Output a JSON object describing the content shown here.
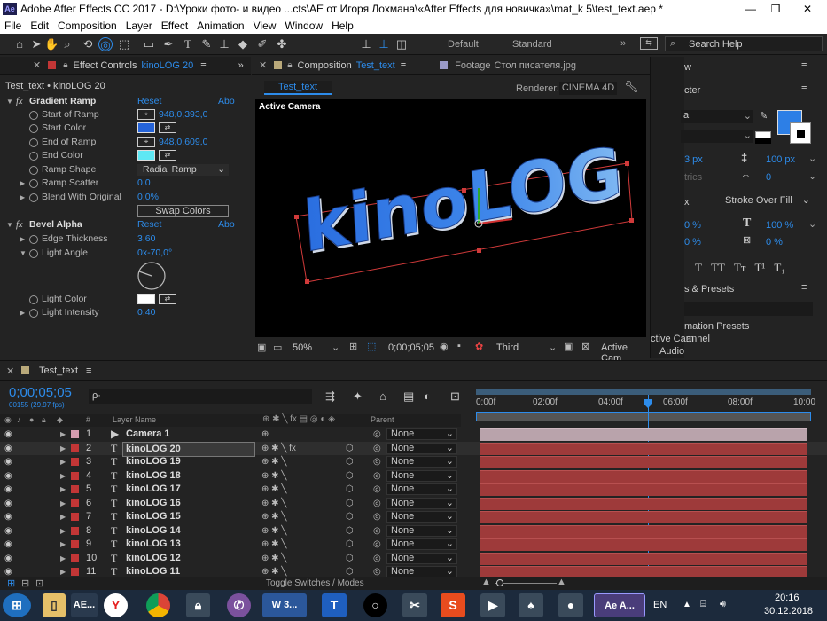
{
  "window": {
    "title": "Adobe After Effects CC 2017 - D:\\Уроки фото- и видео ...cts\\AE от Игоря Лохмана\\«After Effects для новичка»\\mat_k 5\\test_text.aep *",
    "min": "—",
    "max": "❐",
    "close": "✕"
  },
  "menu": [
    "File",
    "Edit",
    "Composition",
    "Layer",
    "Effect",
    "Animation",
    "View",
    "Window",
    "Help"
  ],
  "toolbar": {
    "workspaces": [
      "Default",
      "Standard"
    ],
    "search_placeholder": "Search Help"
  },
  "effect_controls": {
    "tab": "Effect Controls",
    "layer": "kinoLOG 20",
    "breadcrumb": "Test_text • kinoLOG 20",
    "gradient": {
      "name": "Gradient Ramp",
      "reset": "Reset",
      "abo": "Abo",
      "props": [
        {
          "name": "Start of Ramp",
          "value": "948,0,393,0"
        },
        {
          "name": "Start Color"
        },
        {
          "name": "End of Ramp",
          "value": "948,0,609,0"
        },
        {
          "name": "End Color"
        },
        {
          "name": "Ramp Shape",
          "value": "Radial Ramp"
        },
        {
          "name": "Ramp Scatter",
          "value": "0,0"
        },
        {
          "name": "Blend With Original",
          "value": "0,0%"
        }
      ],
      "swap": "Swap Colors",
      "start_color": "#2563d8",
      "end_color": "#5ee8f4"
    },
    "bevel": {
      "name": "Bevel Alpha",
      "reset": "Reset",
      "abo": "Abo",
      "props": [
        {
          "name": "Edge Thickness",
          "value": "3,60"
        },
        {
          "name": "Light Angle",
          "value": "0x-70,0°"
        },
        {
          "name": "Light Color"
        },
        {
          "name": "Light Intensity",
          "value": "0,40"
        }
      ],
      "light_color": "#ffffff"
    }
  },
  "composition": {
    "tab": "Composition",
    "name": "Test_text",
    "footage_tab": "Footage",
    "footage_name": "Стол писателя.jpg",
    "sub_tab": "Test_text",
    "renderer_label": "Renderer:",
    "renderer": "CINEMA 4D",
    "camera_label": "Active Camera",
    "text": "kinoLOG",
    "footer": {
      "zoom": "50%",
      "time": "0;00;05;05",
      "view": "Third",
      "camera": "Active Cam"
    }
  },
  "right_panel": {
    "tab1": "w",
    "tab2": "cter",
    "font_size": "3 px",
    "leading": "100 px",
    "tracking_v": "0",
    "stroke": "Stroke Over Fill",
    "scale_v": "100 %",
    "scale_h": "0 %",
    "pct1": "0 %",
    "pct2": "0 %",
    "styles": [
      "T",
      "TT",
      "Tт",
      "T¹",
      "T₁"
    ],
    "presets_title": "s & Presets",
    "presets": [
      "mation Presets",
      "ctive Cam",
      "annel",
      "Audio"
    ]
  },
  "timeline": {
    "comp": "Test_text",
    "timecode": "0;00;05;05",
    "fps": "00155 (29.97 fps)",
    "search_placeholder": "ρ·",
    "ruler": [
      "0:00f",
      "02:00f",
      "04:00f",
      "06:00f",
      "08:00f",
      "10:00"
    ],
    "col_layer": "Layer Name",
    "col_parent": "Parent",
    "col_num": "#",
    "toggle": "Toggle Switches / Modes",
    "layers": [
      {
        "num": "1",
        "name": "Camera 1",
        "type": "cam",
        "parent": "None"
      },
      {
        "num": "2",
        "name": "kinoLOG 20",
        "type": "T",
        "parent": "None"
      },
      {
        "num": "3",
        "name": "kinoLOG 19",
        "type": "T",
        "parent": "None"
      },
      {
        "num": "4",
        "name": "kinoLOG 18",
        "type": "T",
        "parent": "None"
      },
      {
        "num": "5",
        "name": "kinoLOG 17",
        "type": "T",
        "parent": "None"
      },
      {
        "num": "6",
        "name": "kinoLOG 16",
        "type": "T",
        "parent": "None"
      },
      {
        "num": "7",
        "name": "kinoLOG 15",
        "type": "T",
        "parent": "None"
      },
      {
        "num": "8",
        "name": "kinoLOG 14",
        "type": "T",
        "parent": "None"
      },
      {
        "num": "9",
        "name": "kinoLOG 13",
        "type": "T",
        "parent": "None"
      },
      {
        "num": "10",
        "name": "kinoLOG 12",
        "type": "T",
        "parent": "None"
      },
      {
        "num": "11",
        "name": "kinoLOG 11",
        "type": "T",
        "parent": "None"
      }
    ]
  },
  "taskbar": {
    "apps": [
      "AE...",
      "Y",
      "",
      "",
      "",
      "W 3...",
      "T",
      "",
      "",
      "S",
      "",
      "",
      "",
      "Ae A..."
    ],
    "lang": "EN",
    "time": "20:16",
    "date": "30.12.2018"
  }
}
